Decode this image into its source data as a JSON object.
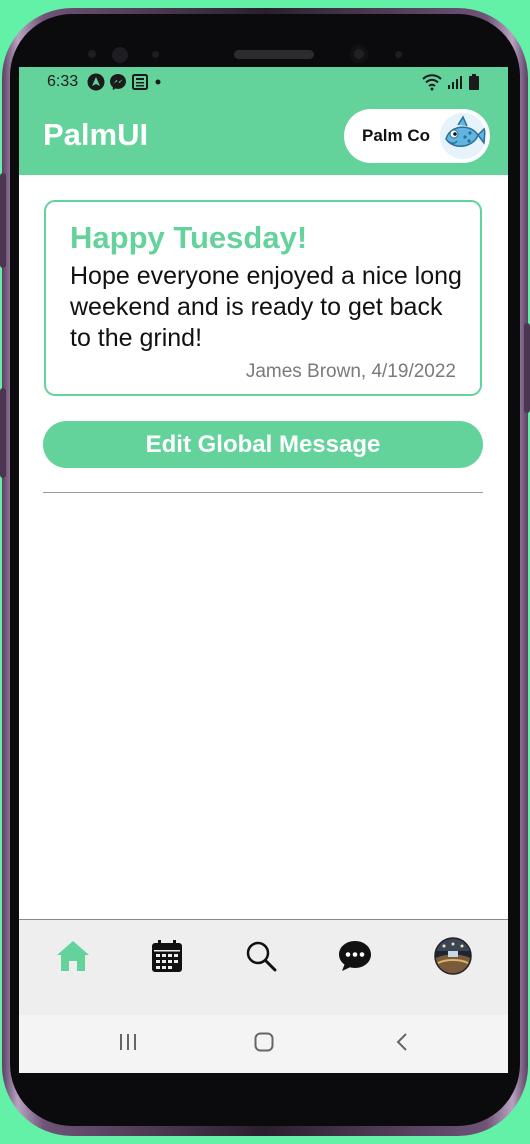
{
  "status_bar": {
    "time": "6:33",
    "left_icons": [
      "navigation-icon",
      "messenger-icon",
      "news-icon",
      "dot-icon"
    ],
    "right_icons": [
      "wifi-icon",
      "signal-icon",
      "battery-icon"
    ]
  },
  "app_bar": {
    "title": "PalmUI",
    "company_label": "Palm Co",
    "company_avatar_icon": "fish-avatar-icon"
  },
  "message_card": {
    "title": "Happy Tuesday!",
    "body": "Hope everyone enjoyed a nice long weekend and is ready to get back to the grind!",
    "author_date": "James Brown, 4/19/2022"
  },
  "edit_button_label": "Edit Global Message",
  "tab_bar": {
    "items": [
      {
        "name": "home",
        "icon": "home-icon",
        "active": true
      },
      {
        "name": "calendar",
        "icon": "calendar-icon",
        "active": false
      },
      {
        "name": "search",
        "icon": "search-icon",
        "active": false
      },
      {
        "name": "messages",
        "icon": "chat-bubble-icon",
        "active": false
      },
      {
        "name": "profile",
        "icon": "profile-avatar-icon",
        "active": false
      }
    ]
  },
  "system_nav": [
    "recents-icon",
    "home-circle-icon",
    "back-icon"
  ],
  "colors": {
    "accent": "#63d39b",
    "background_frame": "#63f0a7",
    "meta_text": "#7a7a7a"
  }
}
